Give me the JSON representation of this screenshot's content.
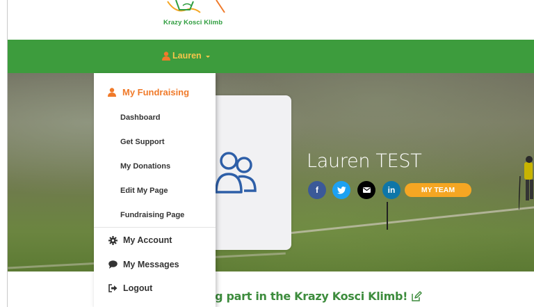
{
  "header": {
    "logo_text": "Krazy Kosci Klimb"
  },
  "nav": {
    "user_label": "Lauren"
  },
  "hero": {
    "name": "Lauren TEST",
    "team_button": "MY TEAM",
    "social": [
      {
        "icon": "facebook-icon",
        "glyph": "f",
        "color": "#3b5998"
      },
      {
        "icon": "twitter-icon",
        "color": "#1da1f2"
      },
      {
        "icon": "email-icon",
        "color": "#000000"
      },
      {
        "icon": "linkedin-icon",
        "glyph": "in",
        "color": "#0e76a8"
      }
    ]
  },
  "dropdown": {
    "heading": "My Fundraising",
    "sub_items": [
      "Dashboard",
      "Get Support",
      "My Donations",
      "Edit My Page",
      "Fundraising Page"
    ],
    "main_items": [
      {
        "label": "My Account",
        "icon": "gear-icon"
      },
      {
        "label": "My Messages",
        "icon": "speech-bubble-icon"
      },
      {
        "label": "Logout",
        "icon": "logout-icon"
      }
    ]
  },
  "main": {
    "intro_text": "ng part in the Krazy Kosci Klimb!"
  },
  "colors": {
    "nav_green": "#3d9c3d",
    "user_yellow": "#f7c64b",
    "heading_orange": "#f07a2a",
    "team_orange": "#f5a623",
    "text_green": "#3d8c3d"
  }
}
